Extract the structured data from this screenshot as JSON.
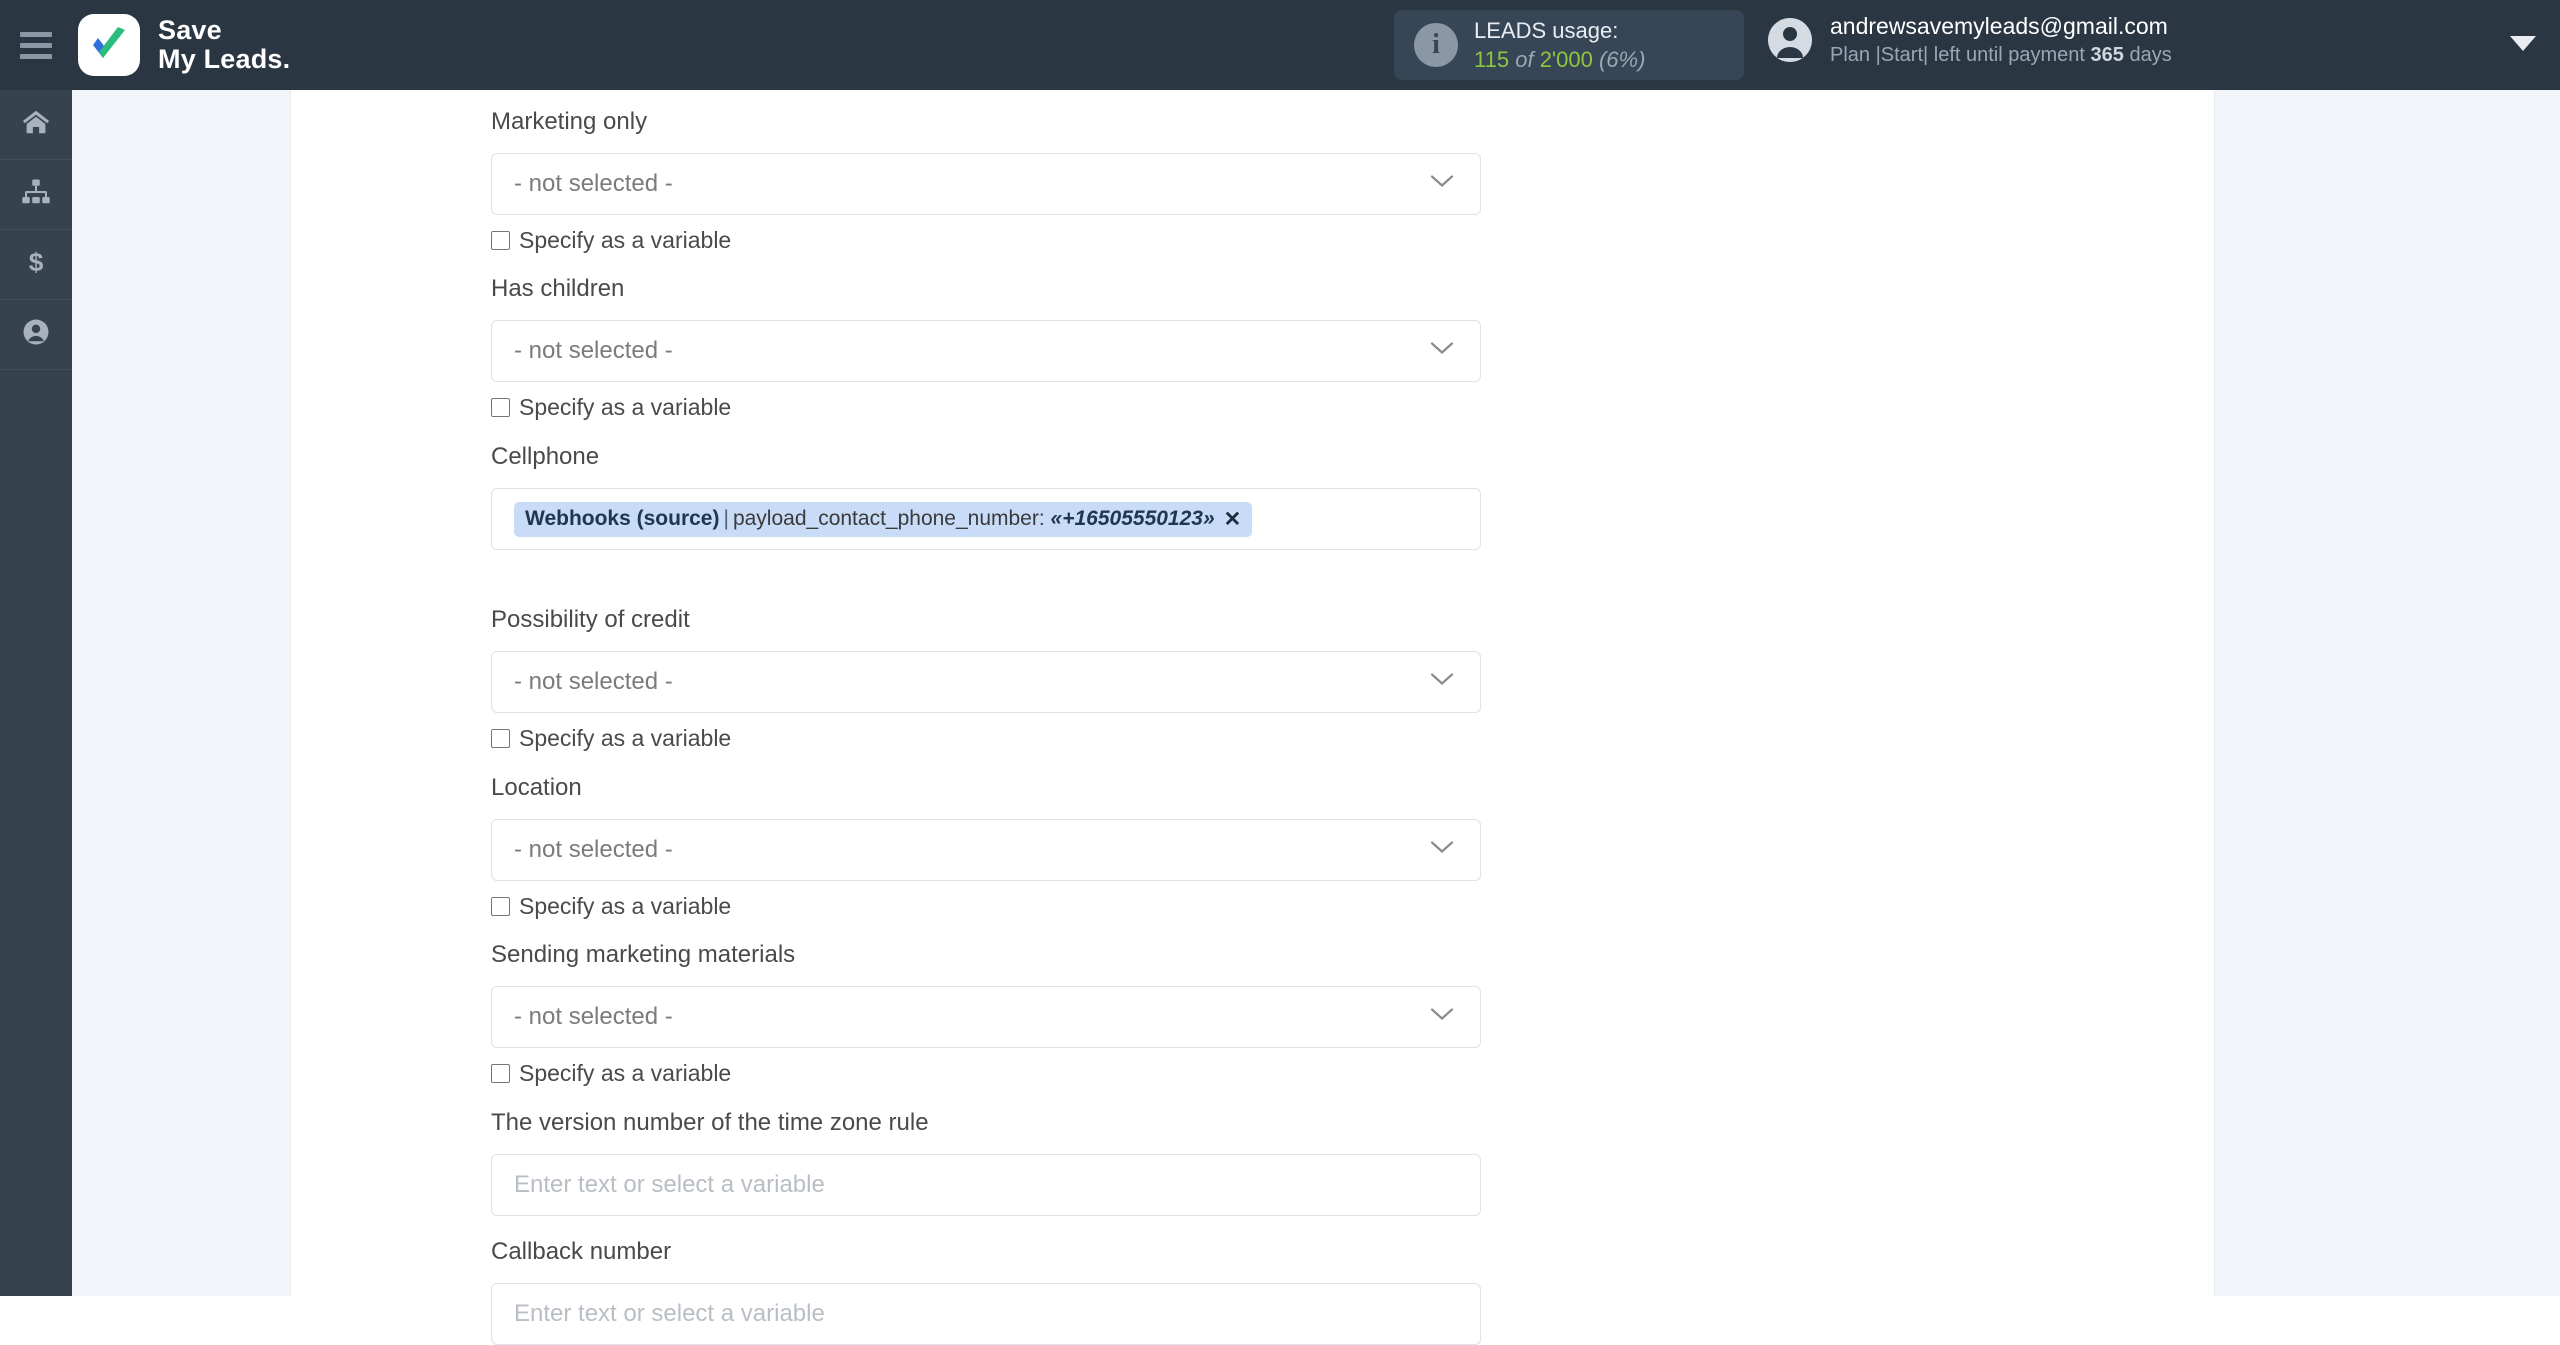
{
  "topbar": {
    "menu_icon": "hamburger-icon",
    "brand_line1": "Save",
    "brand_line2": "My Leads.",
    "usage": {
      "info_glyph": "i",
      "title": "LEADS usage:",
      "used": "115",
      "of": "of",
      "total": "2'000",
      "percent": "(6%)"
    },
    "account": {
      "email": "andrewsavemyleads@gmail.com",
      "plan_prefix": "Plan |Start| left until payment ",
      "plan_days": "365",
      "plan_suffix": " days"
    }
  },
  "sidebar": {
    "items": [
      {
        "name": "home",
        "icon": "home-icon"
      },
      {
        "name": "connections",
        "icon": "sitemap-icon"
      },
      {
        "name": "billing",
        "icon": "dollar-icon"
      },
      {
        "name": "profile",
        "icon": "user-icon"
      }
    ]
  },
  "form": {
    "not_selected": "- not selected -",
    "enter_text_placeholder": "Enter text or select a variable",
    "specify_variable": "Specify as a variable",
    "fields": [
      {
        "label": "Marketing only",
        "type": "select",
        "value": "- not selected -",
        "has_checkbox": true
      },
      {
        "label": "Has children",
        "type": "select",
        "value": "- not selected -",
        "has_checkbox": true
      },
      {
        "label": "Cellphone",
        "type": "tag",
        "has_checkbox": false
      },
      {
        "label": "Possibility of credit",
        "type": "select",
        "value": "- not selected -",
        "has_checkbox": true
      },
      {
        "label": "Location",
        "type": "select",
        "value": "- not selected -",
        "has_checkbox": true
      },
      {
        "label": "Sending marketing materials",
        "type": "select",
        "value": "- not selected -",
        "has_checkbox": true
      },
      {
        "label": "The version number of the time zone rule",
        "type": "text",
        "value": "",
        "has_checkbox": false
      },
      {
        "label": "Callback number",
        "type": "text",
        "value": "",
        "has_checkbox": false
      }
    ],
    "cellphone_tag": {
      "source": "Webhooks (source)",
      "separator": "|",
      "key": "payload_contact_phone_number:",
      "value": "«+16505550123»",
      "remove": "✕"
    }
  },
  "colors": {
    "topbar": "#2b3643",
    "sidebar": "#37424f",
    "page_bg": "#f2f5fa",
    "accent_green": "#8fc63f",
    "tag_bg": "#c9dcf7"
  }
}
